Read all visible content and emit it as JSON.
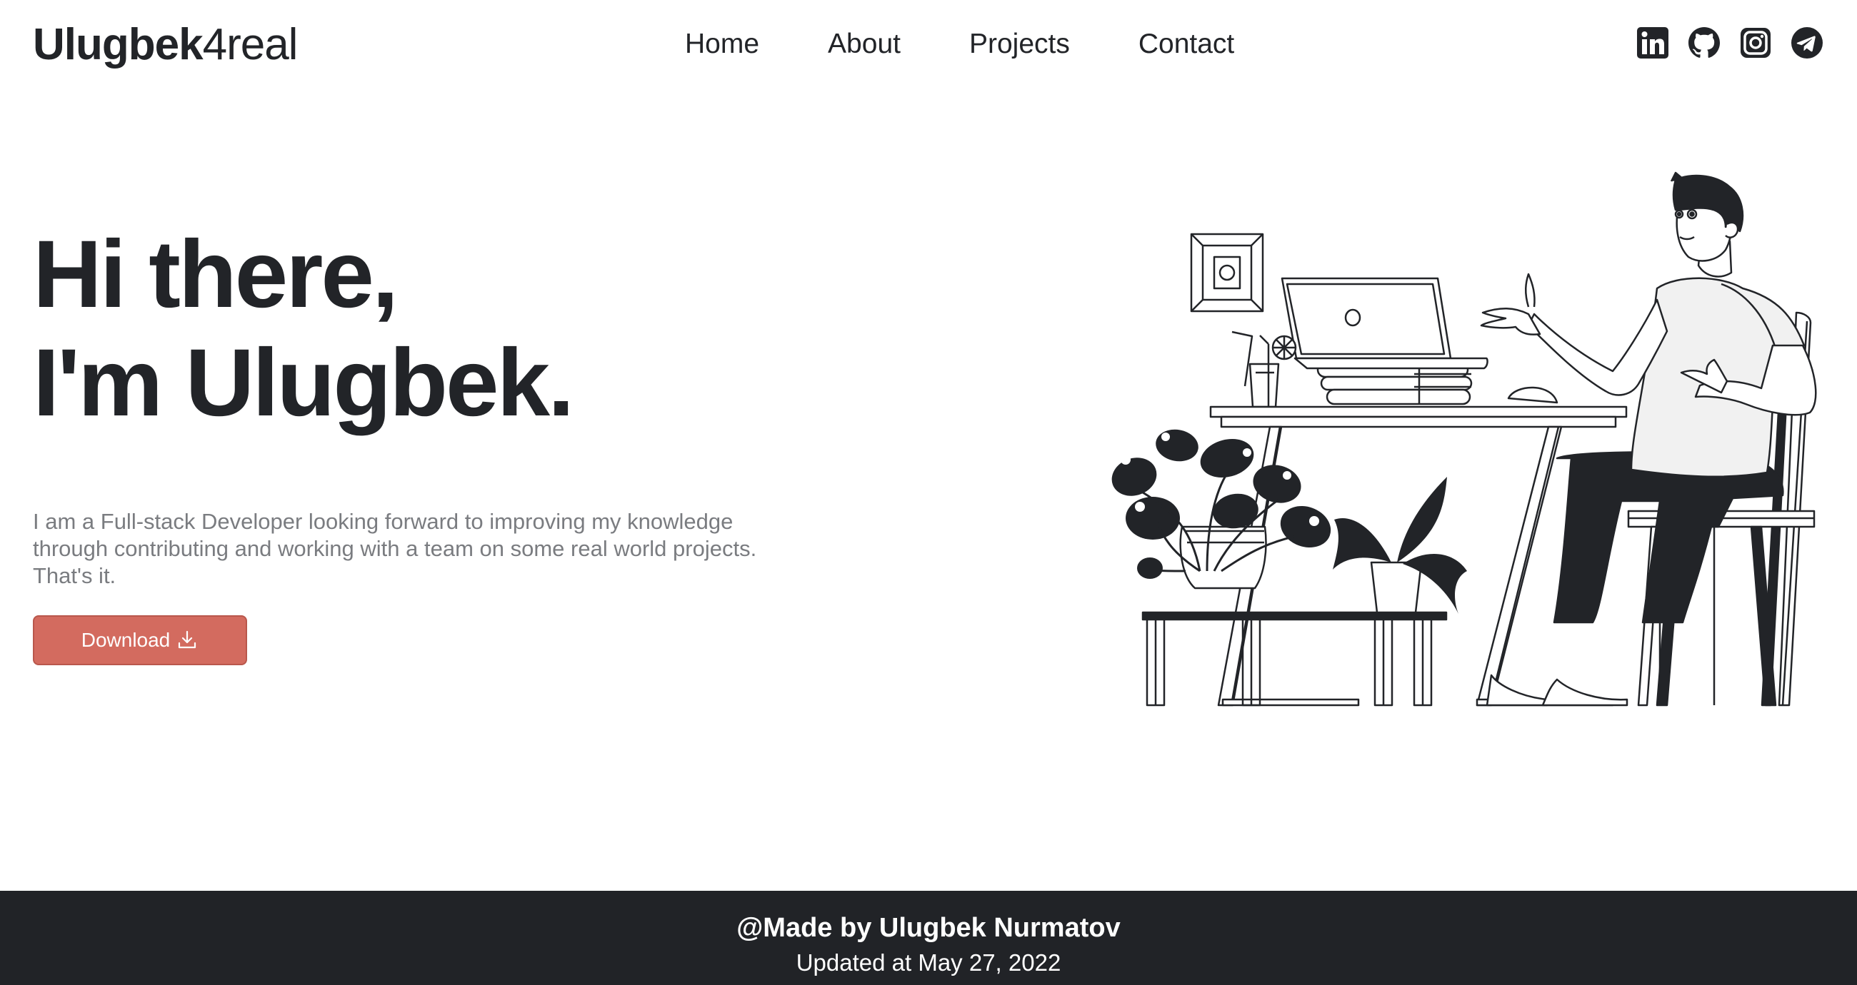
{
  "header": {
    "logo_bold": "Ulugbek",
    "logo_light": "4real",
    "nav": [
      "Home",
      "About",
      "Projects",
      "Contact"
    ],
    "social_icons": [
      "linkedin-icon",
      "github-icon",
      "instagram-icon",
      "telegram-icon"
    ]
  },
  "hero": {
    "greeting_line1": "Hi there,",
    "greeting_line2": "I'm Ulugbek.",
    "description": "I am a Full-stack Developer looking forward to improving my knowledge through contributing and working with a team on some real world projects. That's it.",
    "download_label": "Download",
    "download_icon": "download-icon"
  },
  "illustration": {
    "subject": "person-at-desk-illustration"
  },
  "footer": {
    "made_by": "@Made by Ulugbek Nurmatov",
    "updated": "Updated at May 27, 2022"
  },
  "colors": {
    "text": "#222428",
    "muted": "#7a7c80",
    "accent": "#d36b5f",
    "footer_bg": "#212327"
  }
}
